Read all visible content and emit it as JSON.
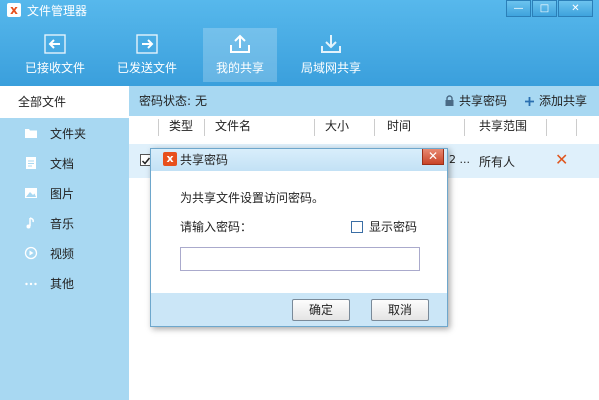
{
  "window": {
    "title": "文件管理器"
  },
  "toolbar": [
    {
      "label": "已接收文件",
      "icon": "received-files-icon"
    },
    {
      "label": "已发送文件",
      "icon": "sent-files-icon"
    },
    {
      "label": "我的共享",
      "icon": "my-share-icon",
      "active": true
    },
    {
      "label": "局域网共享",
      "icon": "lan-share-icon"
    }
  ],
  "sidebar": {
    "all": "全部文件",
    "items": [
      {
        "label": "文件夹",
        "icon": "folder-icon"
      },
      {
        "label": "文档",
        "icon": "document-icon"
      },
      {
        "label": "图片",
        "icon": "image-icon"
      },
      {
        "label": "音乐",
        "icon": "music-icon"
      },
      {
        "label": "视频",
        "icon": "video-icon"
      },
      {
        "label": "其他",
        "icon": "more-icon"
      }
    ]
  },
  "statusbar": {
    "label": "密码状态:",
    "value": "无",
    "share_password": "共享密码",
    "add_share": "添加共享"
  },
  "table": {
    "columns": [
      "类型",
      "文件名",
      "大小",
      "时间",
      "共享范围"
    ],
    "rows": [
      {
        "time_fragment": "2 ...",
        "scope": "所有人",
        "checked": true
      }
    ]
  },
  "dialog": {
    "title": "共享密码",
    "description": "为共享文件设置访问密码。",
    "prompt": "请输入密码：",
    "show_password": "显示密码",
    "password_value": "",
    "ok": "确定",
    "cancel": "取消"
  },
  "colors": {
    "accent": "#3a9fdc",
    "sidebar": "#a8d8f2",
    "delete": "#e0561e"
  }
}
